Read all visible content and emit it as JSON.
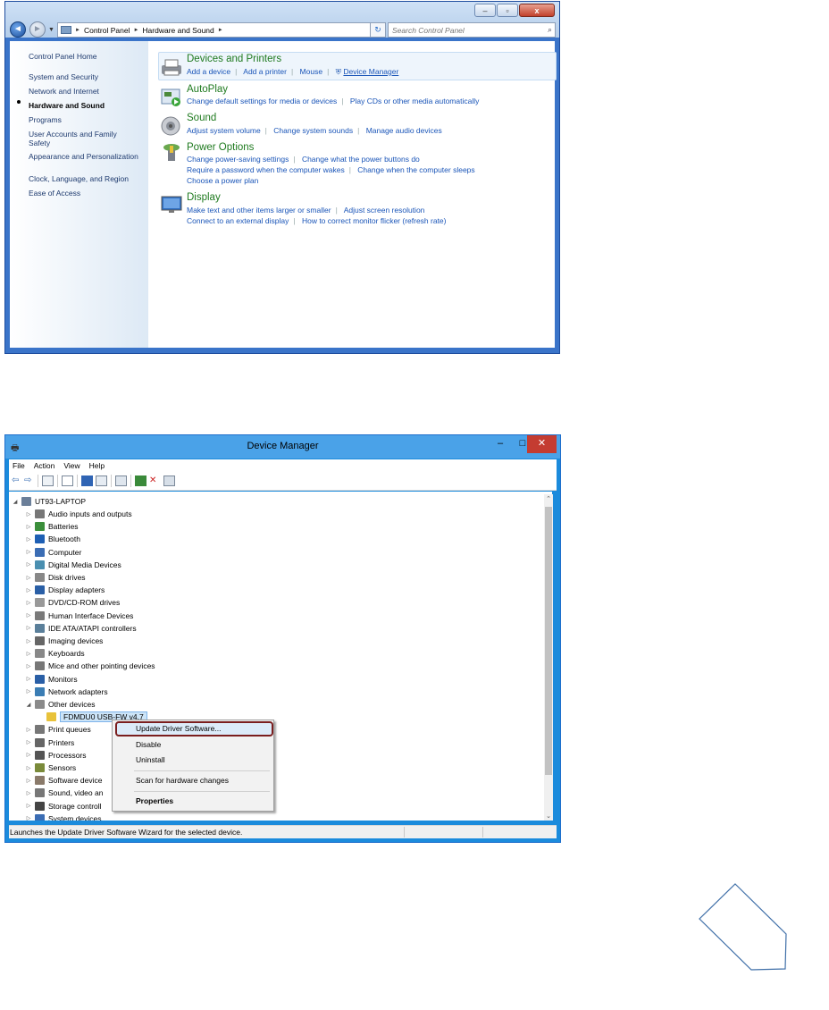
{
  "control_panel": {
    "caption_buttons": {
      "minimize": "‒",
      "maximize": "▫",
      "close": "x"
    },
    "breadcrumbs": [
      "Control Panel",
      "Hardware and Sound"
    ],
    "search_placeholder": "Search Control Panel",
    "sidebar": {
      "home": "Control Panel Home",
      "items": [
        "System and Security",
        "Network and Internet",
        "Hardware and Sound",
        "Programs",
        "User Accounts and Family Safety",
        "Appearance and Personalization",
        "Clock, Language, and Region",
        "Ease of Access"
      ],
      "active_item": "Hardware and Sound"
    },
    "categories": [
      {
        "title": "Devices and Printers",
        "icon": "printer-icon",
        "lines": [
          [
            "Add a device",
            "Add a printer",
            "Mouse",
            "Device Manager"
          ]
        ]
      },
      {
        "title": "AutoPlay",
        "icon": "autoplay-icon",
        "lines": [
          [
            "Change default settings for media or devices",
            "Play CDs or other media automatically"
          ]
        ]
      },
      {
        "title": "Sound",
        "icon": "speaker-icon",
        "lines": [
          [
            "Adjust system volume",
            "Change system sounds",
            "Manage audio devices"
          ]
        ]
      },
      {
        "title": "Power Options",
        "icon": "power-icon",
        "lines": [
          [
            "Change power-saving settings",
            "Change what the power buttons do"
          ],
          [
            "Require a password when the computer wakes",
            "Change when the computer sleeps"
          ],
          [
            "Choose a power plan"
          ]
        ]
      },
      {
        "title": "Display",
        "icon": "monitor-icon",
        "lines": [
          [
            "Make text and other items larger or smaller",
            "Adjust screen resolution"
          ],
          [
            "Connect to an external display",
            "How to correct monitor flicker (refresh rate)"
          ]
        ]
      }
    ]
  },
  "device_manager": {
    "title": "Device Manager",
    "caption_buttons": {
      "minimize": "–",
      "maximize": "□",
      "close": "✕"
    },
    "menu": [
      "File",
      "Action",
      "View",
      "Help"
    ],
    "root": "UT93-LAPTOP",
    "tree": [
      {
        "label": "Audio inputs and outputs",
        "color": "#777"
      },
      {
        "label": "Batteries",
        "color": "#3b8f3b"
      },
      {
        "label": "Bluetooth",
        "color": "#1e5fb4"
      },
      {
        "label": "Computer",
        "color": "#3b6db4"
      },
      {
        "label": "Digital Media Devices",
        "color": "#4a8fb0"
      },
      {
        "label": "Disk drives",
        "color": "#888"
      },
      {
        "label": "Display adapters",
        "color": "#2a5fa6"
      },
      {
        "label": "DVD/CD-ROM drives",
        "color": "#999"
      },
      {
        "label": "Human Interface Devices",
        "color": "#7a7a7a"
      },
      {
        "label": "IDE ATA/ATAPI controllers",
        "color": "#5a7f9a"
      },
      {
        "label": "Imaging devices",
        "color": "#666"
      },
      {
        "label": "Keyboards",
        "color": "#888"
      },
      {
        "label": "Mice and other pointing devices",
        "color": "#777"
      },
      {
        "label": "Monitors",
        "color": "#2a5fa6"
      },
      {
        "label": "Network adapters",
        "color": "#3b7db4"
      },
      {
        "label": "Other devices",
        "color": "#8a8a8a"
      },
      {
        "label": "Print queues",
        "color": "#777"
      },
      {
        "label": "Printers",
        "color": "#666"
      },
      {
        "label": "Processors",
        "color": "#555"
      },
      {
        "label": "Sensors",
        "color": "#7a8a3a"
      },
      {
        "label": "Software device",
        "color": "#8a7a6a"
      },
      {
        "label": "Sound, video an",
        "color": "#777"
      },
      {
        "label": "Storage controll",
        "color": "#444"
      },
      {
        "label": "System devices",
        "color": "#3b6db4"
      }
    ],
    "selected_child": "FDMDU0 USB-FW v4.7",
    "context_menu": [
      "Update Driver Software...",
      "Disable",
      "Uninstall",
      "Scan for hardware changes",
      "Properties"
    ],
    "status_text": "Launches the Update Driver Software Wizard for the selected device."
  }
}
